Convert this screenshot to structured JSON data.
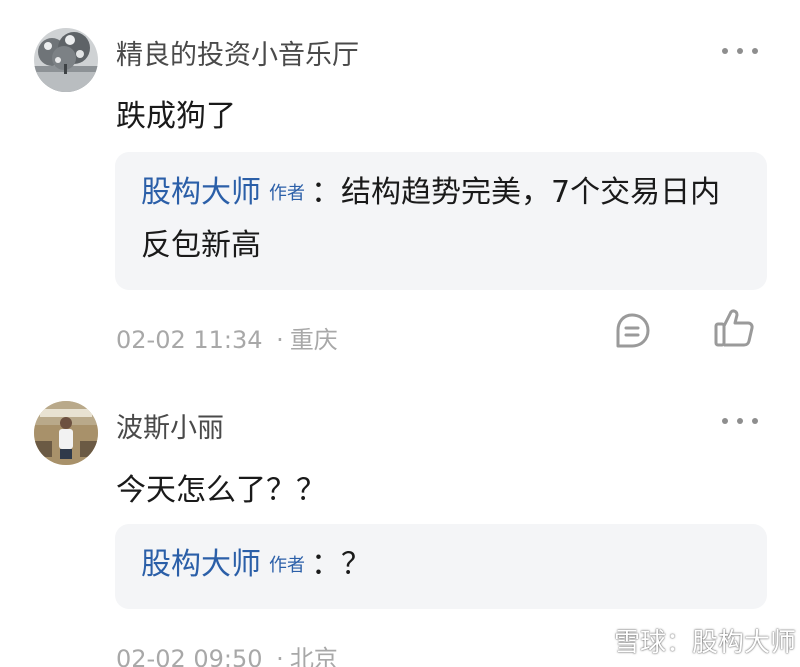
{
  "comments": [
    {
      "username": "精良的投资小音乐厅",
      "text": "跌成狗了",
      "reply": {
        "author": "股构大师",
        "badge": "作者",
        "separator": "：",
        "text": "结构趋势完美，7个交易日内反包新高"
      },
      "time": "02-02 11:34",
      "dot": "·",
      "location": "重庆"
    },
    {
      "username": "波斯小丽",
      "text": "今天怎么了？？",
      "reply": {
        "author": "股构大师",
        "badge": "作者",
        "separator": "：",
        "text": "？"
      },
      "time": "02-02 09:50",
      "dot": "·",
      "location": "北京"
    }
  ],
  "watermark": {
    "text": "雪球：股构大师"
  },
  "icons": {
    "comment": "comment-bubble-icon",
    "like": "thumbs-up-icon",
    "more": "more-dots-icon"
  },
  "colors": {
    "author_blue": "#2b5fa8",
    "reply_bg": "#f4f5f7",
    "meta_gray": "#a8a8a8"
  }
}
